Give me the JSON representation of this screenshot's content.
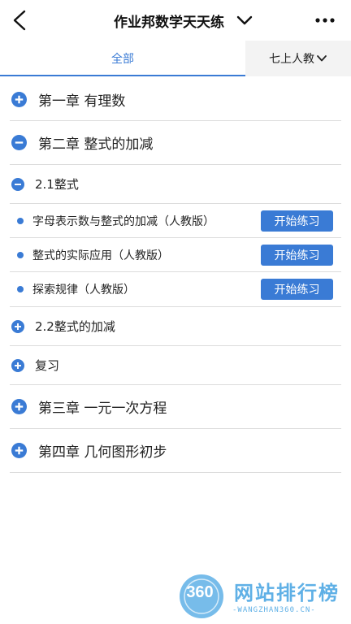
{
  "header": {
    "title": "作业邦数学天天练",
    "back_icon": "chevron-left-icon",
    "menu_icon": "chevron-down-icon",
    "more_icon": "more-dots-icon"
  },
  "tabs": {
    "all_label": "全部",
    "grade_label": "七上人教",
    "accent_color": "#3a7bd5"
  },
  "tree": {
    "chapter1": {
      "label": "第一章 有理数",
      "expanded": false
    },
    "chapter2": {
      "label": "第二章 整式的加减",
      "expanded": true,
      "section1": {
        "label": "2.1整式",
        "expanded": true,
        "lessons": [
          {
            "label": "字母表示数与整式的加减（人教版）",
            "button": "开始练习"
          },
          {
            "label": "整式的实际应用（人教版）",
            "button": "开始练习"
          },
          {
            "label": "探索规律（人教版）",
            "button": "开始练习"
          }
        ]
      },
      "section2": {
        "label": "2.2整式的加减",
        "expanded": false
      },
      "section3": {
        "label": "复习",
        "expanded": false
      }
    },
    "chapter3": {
      "label": "第三章 一元一次方程",
      "expanded": false
    },
    "chapter4": {
      "label": "第四章 几何图形初步",
      "expanded": false
    }
  },
  "watermark": {
    "badge": "360",
    "brand": "网站排行榜",
    "sub": "-WANGZHAN360.CN-"
  }
}
